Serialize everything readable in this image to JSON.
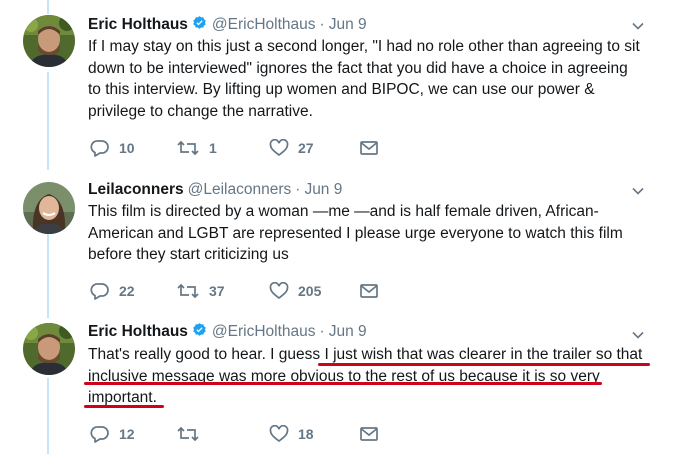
{
  "tweets": [
    {
      "name": "Eric Holthaus",
      "handle": "@EricHolthaus",
      "date": "Jun 9",
      "verified": true,
      "lines": [
        "If I may stay on this just a second longer, \"I had no role other than agreeing to sit",
        "down to be interviewed\" ignores the fact that you did have a choice in agreeing",
        "to this interview. By lifting up women and BIPOC, we can use our power &",
        "privilege to change the narrative."
      ],
      "replies": "10",
      "retweets": "1",
      "likes": "27"
    },
    {
      "name": "Leilaconners",
      "handle": "@Leilaconners",
      "date": "Jun 9",
      "verified": false,
      "lines": [
        "This film is directed by a woman —me —and is half female driven, African-",
        "American and LGBT are represented I please urge everyone to watch this film",
        "before they start criticizing us"
      ],
      "replies": "22",
      "retweets": "37",
      "likes": "205"
    },
    {
      "name": "Eric Holthaus",
      "handle": "@EricHolthaus",
      "date": "Jun 9",
      "verified": true,
      "lines": [
        "That's really good to hear. I guess I just wish that was clearer in the trailer so that",
        "inclusive message was more obvious to the rest of us because it is so very",
        "important."
      ],
      "replies": "12",
      "retweets": "",
      "likes": "18"
    }
  ],
  "colors": {
    "text": "#14171a",
    "muted": "#657786",
    "verified": "#1da1f2",
    "thread": "#c4e4f7",
    "annotation": "#d0021b"
  },
  "icons": [
    "verified-badge-icon",
    "chevron-down-icon",
    "reply-icon",
    "retweet-icon",
    "like-icon",
    "message-icon"
  ]
}
